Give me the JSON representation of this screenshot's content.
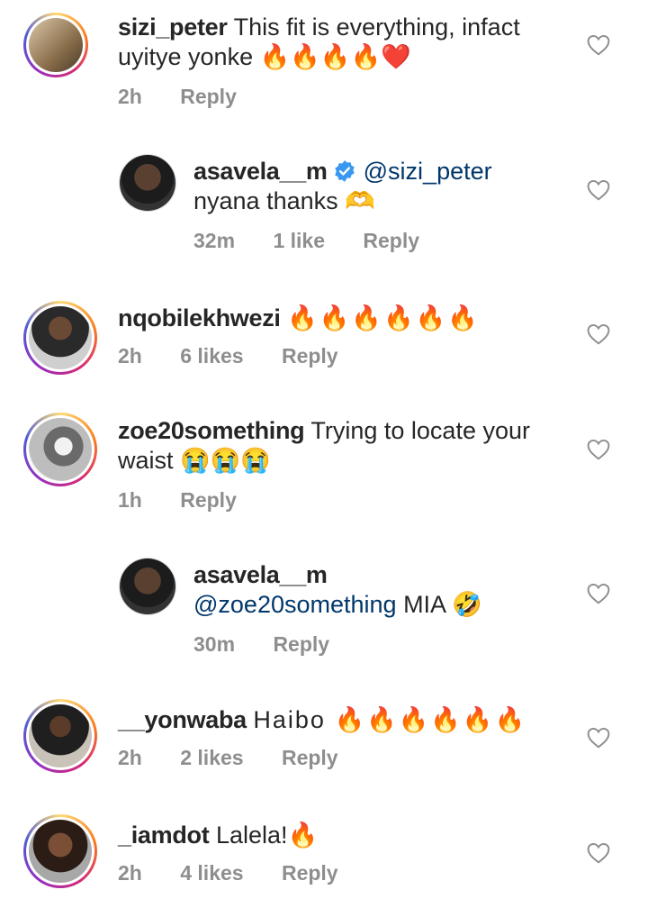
{
  "comments": [
    {
      "username": "sizi_peter",
      "text": "This fit is everything, infact uyitye yonke 🔥🔥🔥🔥❤️",
      "time": "2h",
      "likes": "",
      "reply": "Reply"
    },
    {
      "username": "asavela__m",
      "mention": "@sizi_peter",
      "text": "nyana thanks 🫶",
      "time": "32m",
      "likes": "1 like",
      "reply": "Reply"
    },
    {
      "username": "nqobilekhwezi",
      "text": "🔥🔥🔥🔥🔥🔥",
      "time": "2h",
      "likes": "6 likes",
      "reply": "Reply"
    },
    {
      "username": "zoe20something",
      "text": "Trying to locate your waist 😭😭😭",
      "time": "1h",
      "likes": "",
      "reply": "Reply"
    },
    {
      "username": "asavela__m",
      "mention": "@zoe20something",
      "text": "MIA 🤣",
      "time": "30m",
      "likes": "",
      "reply": "Reply"
    },
    {
      "username": "__yonwaba",
      "text": "Haibo 🔥🔥🔥🔥🔥🔥",
      "time": "2h",
      "likes": "2 likes",
      "reply": "Reply"
    },
    {
      "username": "_iamdot",
      "text": "Lalela!🔥",
      "time": "2h",
      "likes": "4 likes",
      "reply": "Reply"
    }
  ],
  "icons": {
    "like": "heart-outline-icon",
    "verified": "verified-badge-icon"
  },
  "colors": {
    "mention": "#00376b",
    "meta": "#8e8e8e",
    "text": "#262626"
  }
}
